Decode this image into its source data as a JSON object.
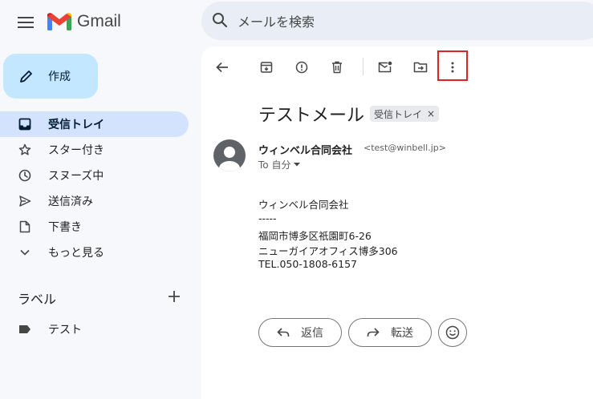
{
  "app": {
    "title": "Gmail"
  },
  "search": {
    "placeholder": "メールを検索"
  },
  "sidebar": {
    "compose_label": "作成",
    "items": [
      {
        "label": "受信トレイ",
        "icon": "inbox-icon"
      },
      {
        "label": "スター付き",
        "icon": "star-icon"
      },
      {
        "label": "スヌーズ中",
        "icon": "clock-icon"
      },
      {
        "label": "送信済み",
        "icon": "send-icon"
      },
      {
        "label": "下書き",
        "icon": "draft-icon"
      },
      {
        "label": "もっと見る",
        "icon": "chevron-down-icon"
      }
    ],
    "labels_heading": "ラベル",
    "labels": [
      {
        "label": "テスト",
        "icon": "label-icon"
      }
    ]
  },
  "message": {
    "subject": "テストメール",
    "label_chip": "受信トレイ",
    "label_chip_close": "×",
    "sender_name": "ウィンベル合同会社",
    "sender_email": "<test@winbell.jp>",
    "to_line": "To 自分",
    "body": [
      "ウィンベル合同会社",
      "-----",
      "福岡市博多区祇園町6-26",
      "ニューガイアオフィス博多306",
      "TEL.050-1808-6157"
    ]
  },
  "actions": {
    "reply": "返信",
    "forward": "転送"
  },
  "colors": {
    "active_nav": "#d3e3fd",
    "compose": "#c2e7ff",
    "highlight": "#e02424",
    "background": "#f6f8fc"
  }
}
